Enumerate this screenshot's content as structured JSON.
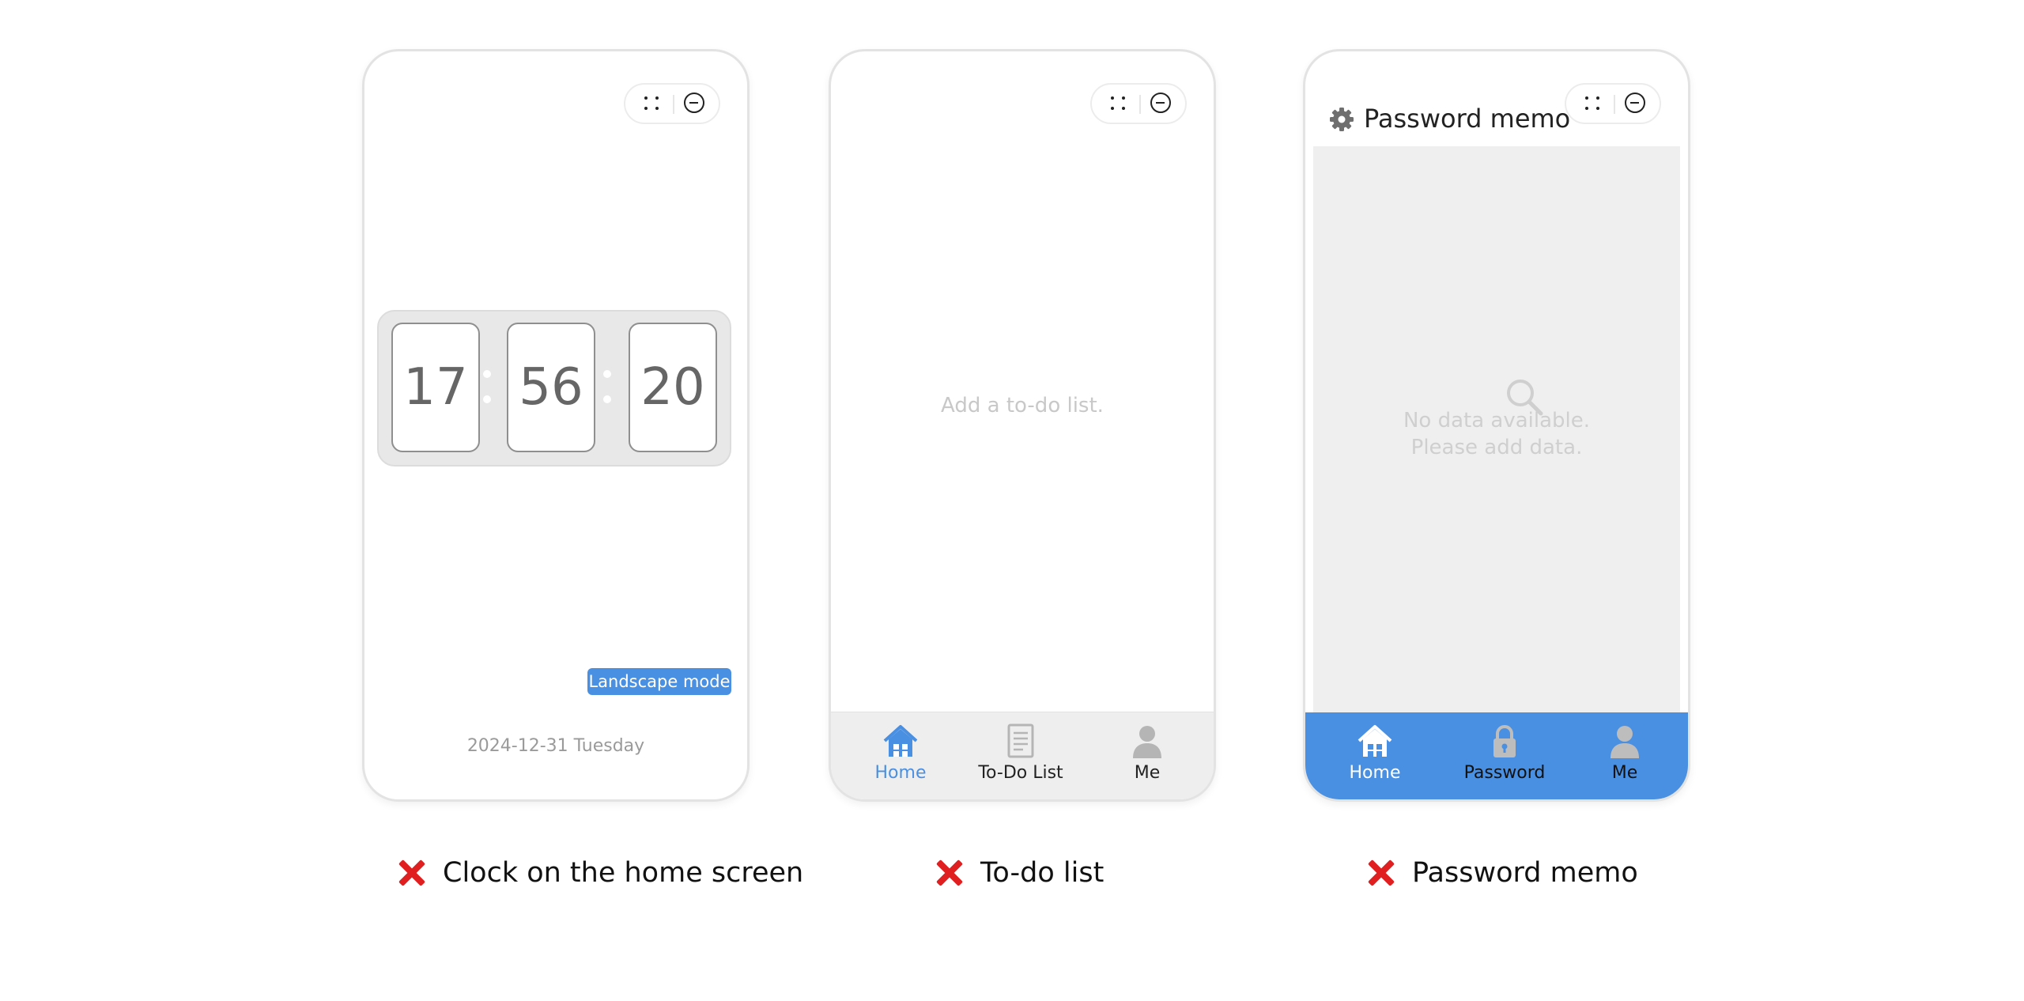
{
  "clock_screen": {
    "hours": "17",
    "minutes": "56",
    "seconds": "20",
    "landscape_button": "Landscape mode",
    "date": "2024-12-31 Tuesday"
  },
  "todo_screen": {
    "empty_message": "Add a to-do list.",
    "tabs": [
      {
        "label": "Home",
        "icon": "home-icon",
        "active": true
      },
      {
        "label": "To-Do List",
        "icon": "checklist-icon",
        "active": false
      },
      {
        "label": "Me",
        "icon": "person-icon",
        "active": false
      }
    ]
  },
  "password_screen": {
    "title": "Password memo",
    "empty_line1": "No data available.",
    "empty_line2": "Please add data.",
    "fab_label": "+",
    "tabs": [
      {
        "label": "Home",
        "icon": "home-icon",
        "active": true
      },
      {
        "label": "Password",
        "icon": "lock-icon",
        "active": false
      },
      {
        "label": "Me",
        "icon": "person-icon",
        "active": false
      }
    ]
  },
  "captions": [
    {
      "mark": "cross-icon",
      "text": "Clock on the home screen"
    },
    {
      "mark": "cross-icon",
      "text": "To-do list"
    },
    {
      "mark": "cross-icon",
      "text": "Password memo"
    }
  ],
  "colors": {
    "accent": "#4a90e2",
    "error_mark": "#e02020",
    "inactive_icon": "#bdbdbd"
  }
}
